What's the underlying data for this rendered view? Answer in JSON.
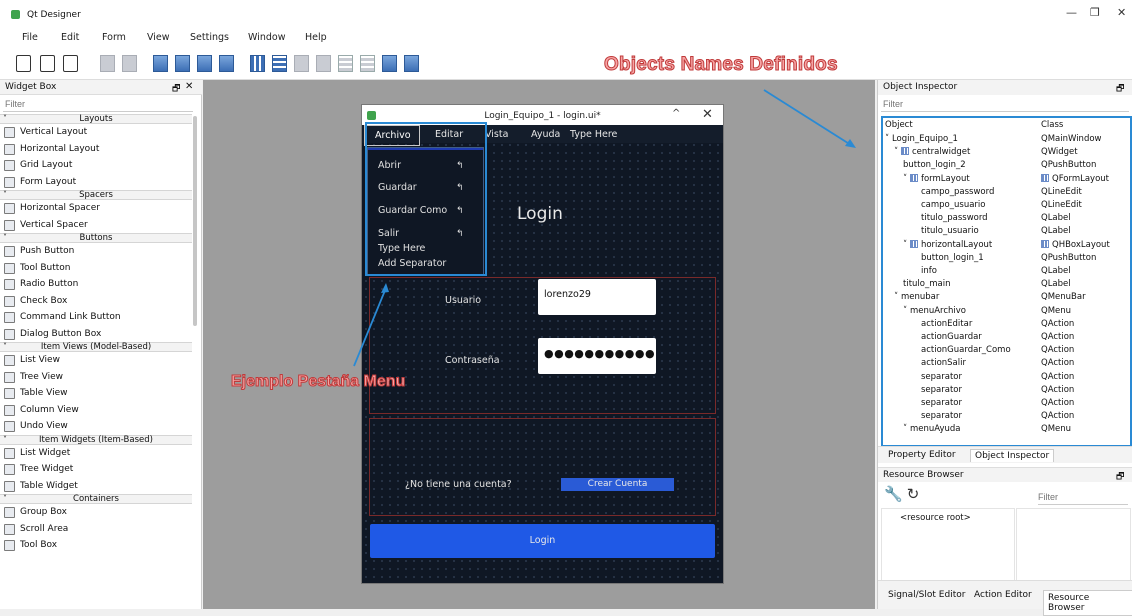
{
  "window": {
    "title": "Qt Designer",
    "min": "—",
    "max": "❐",
    "close": "✕"
  },
  "menubar": [
    "File",
    "Edit",
    "Form",
    "View",
    "Settings",
    "Window",
    "Help"
  ],
  "annotations": {
    "top": "Objects Names Definidos",
    "menu": "Ejemplo Pestaña Menu"
  },
  "widget_box": {
    "title": "Widget Box",
    "filter_placeholder": "Filter",
    "categories": [
      {
        "name": "Layouts",
        "items": [
          "Vertical Layout",
          "Horizontal Layout",
          "Grid Layout",
          "Form Layout"
        ]
      },
      {
        "name": "Spacers",
        "items": [
          "Horizontal Spacer",
          "Vertical Spacer"
        ]
      },
      {
        "name": "Buttons",
        "items": [
          "Push Button",
          "Tool Button",
          "Radio Button",
          "Check Box",
          "Command Link Button",
          "Dialog Button Box"
        ]
      },
      {
        "name": "Item Views (Model-Based)",
        "items": [
          "List View",
          "Tree View",
          "Table View",
          "Column View",
          "Undo View"
        ]
      },
      {
        "name": "Item Widgets (Item-Based)",
        "items": [
          "List Widget",
          "Tree Widget",
          "Table Widget"
        ]
      },
      {
        "name": "Containers",
        "items": [
          "Group Box",
          "Scroll Area",
          "Tool Box"
        ]
      }
    ]
  },
  "form": {
    "title": "Login_Equipo_1 - login.ui*",
    "menus": [
      "Archivo",
      "Editar",
      "Vista",
      "Ayuda",
      "Type Here"
    ],
    "dropdown": [
      "Abrir",
      "Guardar",
      "Guardar Como",
      "Salir",
      "Type Here",
      "Add Separator"
    ],
    "heading": "Login",
    "usuario_label": "Usuario",
    "usuario_value": "lorenzo29",
    "password_label": "Contraseña",
    "password_value": "●●●●●●●●●●●",
    "no_account_label": "¿No tiene una cuenta?",
    "create_button": "Crear Cuenta",
    "login_button": "Login"
  },
  "object_inspector": {
    "title": "Object Inspector",
    "filter_placeholder": "Filter",
    "col_object": "Object",
    "col_class": "Class",
    "rows": [
      {
        "object": "Login_Equipo_1",
        "class": "QMainWindow",
        "indent": 0,
        "expand": true
      },
      {
        "object": "centralwidget",
        "class": "QWidget",
        "indent": 1,
        "expand": true,
        "icon": true
      },
      {
        "object": "button_login_2",
        "class": "QPushButton",
        "indent": 2
      },
      {
        "object": "formLayout",
        "class": "QFormLayout",
        "indent": 2,
        "expand": true,
        "icon": true,
        "class_icon": true
      },
      {
        "object": "campo_password",
        "class": "QLineEdit",
        "indent": 4
      },
      {
        "object": "campo_usuario",
        "class": "QLineEdit",
        "indent": 4
      },
      {
        "object": "titulo_password",
        "class": "QLabel",
        "indent": 4
      },
      {
        "object": "titulo_usuario",
        "class": "QLabel",
        "indent": 4
      },
      {
        "object": "horizontalLayout",
        "class": "QHBoxLayout",
        "indent": 2,
        "expand": true,
        "icon": true,
        "class_icon": true
      },
      {
        "object": "button_login_1",
        "class": "QPushButton",
        "indent": 4
      },
      {
        "object": "info",
        "class": "QLabel",
        "indent": 4
      },
      {
        "object": "titulo_main",
        "class": "QLabel",
        "indent": 2
      },
      {
        "object": "menubar",
        "class": "QMenuBar",
        "indent": 1,
        "expand": true
      },
      {
        "object": "menuArchivo",
        "class": "QMenu",
        "indent": 2,
        "expand": true
      },
      {
        "object": "actionEditar",
        "class": "QAction",
        "indent": 4
      },
      {
        "object": "actionGuardar",
        "class": "QAction",
        "indent": 4
      },
      {
        "object": "actionGuardar_Como",
        "class": "QAction",
        "indent": 4
      },
      {
        "object": "actionSalir",
        "class": "QAction",
        "indent": 4
      },
      {
        "object": "separator",
        "class": "QAction",
        "indent": 4
      },
      {
        "object": "separator",
        "class": "QAction",
        "indent": 4
      },
      {
        "object": "separator",
        "class": "QAction",
        "indent": 4
      },
      {
        "object": "separator",
        "class": "QAction",
        "indent": 4
      },
      {
        "object": "menuAyuda",
        "class": "QMenu",
        "indent": 2,
        "expand": true
      }
    ]
  },
  "inspector_tabs": [
    "Property Editor",
    "Object Inspector"
  ],
  "resource_browser": {
    "title": "Resource Browser",
    "filter_placeholder": "Filter",
    "root": "<resource root>"
  },
  "bottom_tabs": [
    "Signal/Slot Editor",
    "Action Editor",
    "Resource Browser"
  ]
}
